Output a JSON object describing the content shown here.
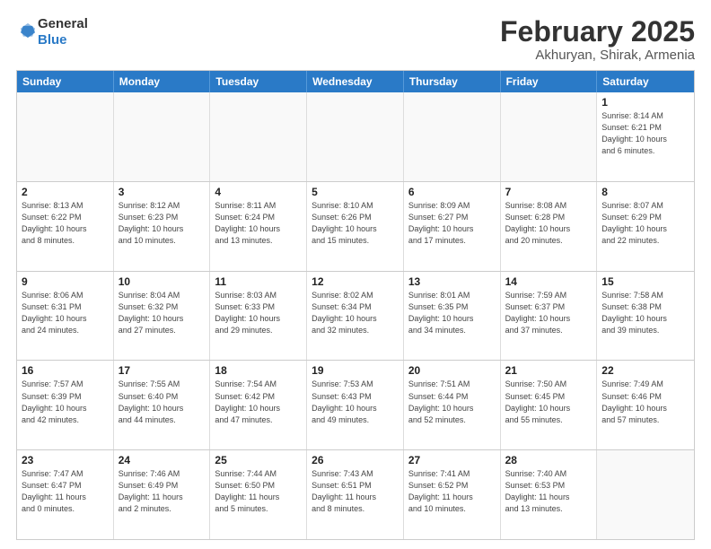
{
  "header": {
    "logo_general": "General",
    "logo_blue": "Blue",
    "title": "February 2025",
    "subtitle": "Akhuryan, Shirak, Armenia"
  },
  "days_of_week": [
    "Sunday",
    "Monday",
    "Tuesday",
    "Wednesday",
    "Thursday",
    "Friday",
    "Saturday"
  ],
  "weeks": [
    [
      {
        "day": "",
        "info": ""
      },
      {
        "day": "",
        "info": ""
      },
      {
        "day": "",
        "info": ""
      },
      {
        "day": "",
        "info": ""
      },
      {
        "day": "",
        "info": ""
      },
      {
        "day": "",
        "info": ""
      },
      {
        "day": "1",
        "info": "Sunrise: 8:14 AM\nSunset: 6:21 PM\nDaylight: 10 hours\nand 6 minutes."
      }
    ],
    [
      {
        "day": "2",
        "info": "Sunrise: 8:13 AM\nSunset: 6:22 PM\nDaylight: 10 hours\nand 8 minutes."
      },
      {
        "day": "3",
        "info": "Sunrise: 8:12 AM\nSunset: 6:23 PM\nDaylight: 10 hours\nand 10 minutes."
      },
      {
        "day": "4",
        "info": "Sunrise: 8:11 AM\nSunset: 6:24 PM\nDaylight: 10 hours\nand 13 minutes."
      },
      {
        "day": "5",
        "info": "Sunrise: 8:10 AM\nSunset: 6:26 PM\nDaylight: 10 hours\nand 15 minutes."
      },
      {
        "day": "6",
        "info": "Sunrise: 8:09 AM\nSunset: 6:27 PM\nDaylight: 10 hours\nand 17 minutes."
      },
      {
        "day": "7",
        "info": "Sunrise: 8:08 AM\nSunset: 6:28 PM\nDaylight: 10 hours\nand 20 minutes."
      },
      {
        "day": "8",
        "info": "Sunrise: 8:07 AM\nSunset: 6:29 PM\nDaylight: 10 hours\nand 22 minutes."
      }
    ],
    [
      {
        "day": "9",
        "info": "Sunrise: 8:06 AM\nSunset: 6:31 PM\nDaylight: 10 hours\nand 24 minutes."
      },
      {
        "day": "10",
        "info": "Sunrise: 8:04 AM\nSunset: 6:32 PM\nDaylight: 10 hours\nand 27 minutes."
      },
      {
        "day": "11",
        "info": "Sunrise: 8:03 AM\nSunset: 6:33 PM\nDaylight: 10 hours\nand 29 minutes."
      },
      {
        "day": "12",
        "info": "Sunrise: 8:02 AM\nSunset: 6:34 PM\nDaylight: 10 hours\nand 32 minutes."
      },
      {
        "day": "13",
        "info": "Sunrise: 8:01 AM\nSunset: 6:35 PM\nDaylight: 10 hours\nand 34 minutes."
      },
      {
        "day": "14",
        "info": "Sunrise: 7:59 AM\nSunset: 6:37 PM\nDaylight: 10 hours\nand 37 minutes."
      },
      {
        "day": "15",
        "info": "Sunrise: 7:58 AM\nSunset: 6:38 PM\nDaylight: 10 hours\nand 39 minutes."
      }
    ],
    [
      {
        "day": "16",
        "info": "Sunrise: 7:57 AM\nSunset: 6:39 PM\nDaylight: 10 hours\nand 42 minutes."
      },
      {
        "day": "17",
        "info": "Sunrise: 7:55 AM\nSunset: 6:40 PM\nDaylight: 10 hours\nand 44 minutes."
      },
      {
        "day": "18",
        "info": "Sunrise: 7:54 AM\nSunset: 6:42 PM\nDaylight: 10 hours\nand 47 minutes."
      },
      {
        "day": "19",
        "info": "Sunrise: 7:53 AM\nSunset: 6:43 PM\nDaylight: 10 hours\nand 49 minutes."
      },
      {
        "day": "20",
        "info": "Sunrise: 7:51 AM\nSunset: 6:44 PM\nDaylight: 10 hours\nand 52 minutes."
      },
      {
        "day": "21",
        "info": "Sunrise: 7:50 AM\nSunset: 6:45 PM\nDaylight: 10 hours\nand 55 minutes."
      },
      {
        "day": "22",
        "info": "Sunrise: 7:49 AM\nSunset: 6:46 PM\nDaylight: 10 hours\nand 57 minutes."
      }
    ],
    [
      {
        "day": "23",
        "info": "Sunrise: 7:47 AM\nSunset: 6:47 PM\nDaylight: 11 hours\nand 0 minutes."
      },
      {
        "day": "24",
        "info": "Sunrise: 7:46 AM\nSunset: 6:49 PM\nDaylight: 11 hours\nand 2 minutes."
      },
      {
        "day": "25",
        "info": "Sunrise: 7:44 AM\nSunset: 6:50 PM\nDaylight: 11 hours\nand 5 minutes."
      },
      {
        "day": "26",
        "info": "Sunrise: 7:43 AM\nSunset: 6:51 PM\nDaylight: 11 hours\nand 8 minutes."
      },
      {
        "day": "27",
        "info": "Sunrise: 7:41 AM\nSunset: 6:52 PM\nDaylight: 11 hours\nand 10 minutes."
      },
      {
        "day": "28",
        "info": "Sunrise: 7:40 AM\nSunset: 6:53 PM\nDaylight: 11 hours\nand 13 minutes."
      },
      {
        "day": "",
        "info": ""
      }
    ]
  ]
}
